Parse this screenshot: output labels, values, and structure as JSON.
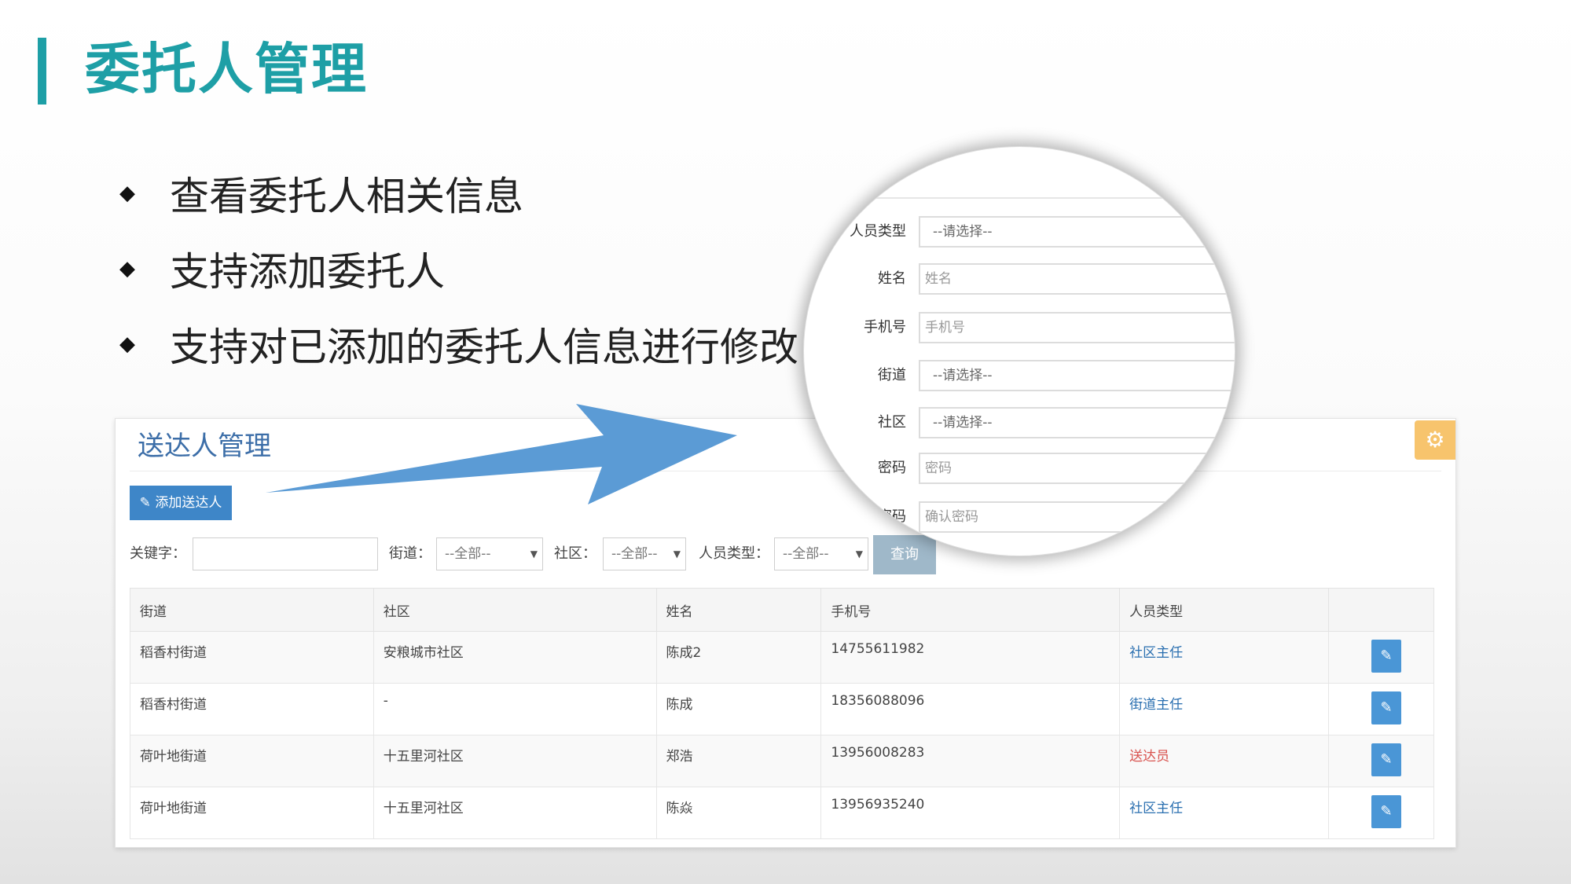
{
  "slide": {
    "title": "委托人管理",
    "bullets": [
      "查看委托人相关信息",
      "支持添加委托人",
      "支持对已添加的委托人信息进行修改"
    ]
  },
  "panel": {
    "title": "送达人管理",
    "add_button": "添加送达人",
    "filters": {
      "keyword_label": "关键字：",
      "street_label": "街道：",
      "street_value": "--全部--",
      "community_label": "社区：",
      "community_value": "--全部--",
      "type_label": "人员类型：",
      "type_value": "--全部--",
      "query_button": "查询"
    },
    "table": {
      "headers": [
        "街道",
        "社区",
        "姓名",
        "手机号",
        "人员类型",
        ""
      ],
      "rows": [
        {
          "street": "稻香村街道",
          "community": "安粮城市社区",
          "name": "陈成2",
          "phone": "14755611982",
          "type": "社区主任"
        },
        {
          "street": "稻香村街道",
          "community": "-",
          "name": "陈成",
          "phone": "18356088096",
          "type": "街道主任"
        },
        {
          "street": "荷叶地街道",
          "community": "十五里河社区",
          "name": "郑浩",
          "phone": "13956008283",
          "type": "送达员"
        },
        {
          "street": "荷叶地街道",
          "community": "十五里河社区",
          "name": "陈焱",
          "phone": "13956935240",
          "type": "社区主任"
        }
      ]
    }
  },
  "magnifier": {
    "fields": [
      {
        "label": "人员类型",
        "value": "--请选择--"
      },
      {
        "label": "姓名",
        "value": "姓名"
      },
      {
        "label": "手机号",
        "value": "手机号"
      },
      {
        "label": "街道",
        "value": "--请选择--"
      },
      {
        "label": "社区",
        "value": "--请选择--"
      },
      {
        "label": "密码",
        "value": "密码"
      },
      {
        "label": "确认密码",
        "value": "确认密码"
      }
    ]
  },
  "colors": {
    "accent": "#1e9fa6",
    "button_blue": "#3e86c8",
    "type_red": "#d9534f",
    "gear_orange": "#f7c46d"
  }
}
